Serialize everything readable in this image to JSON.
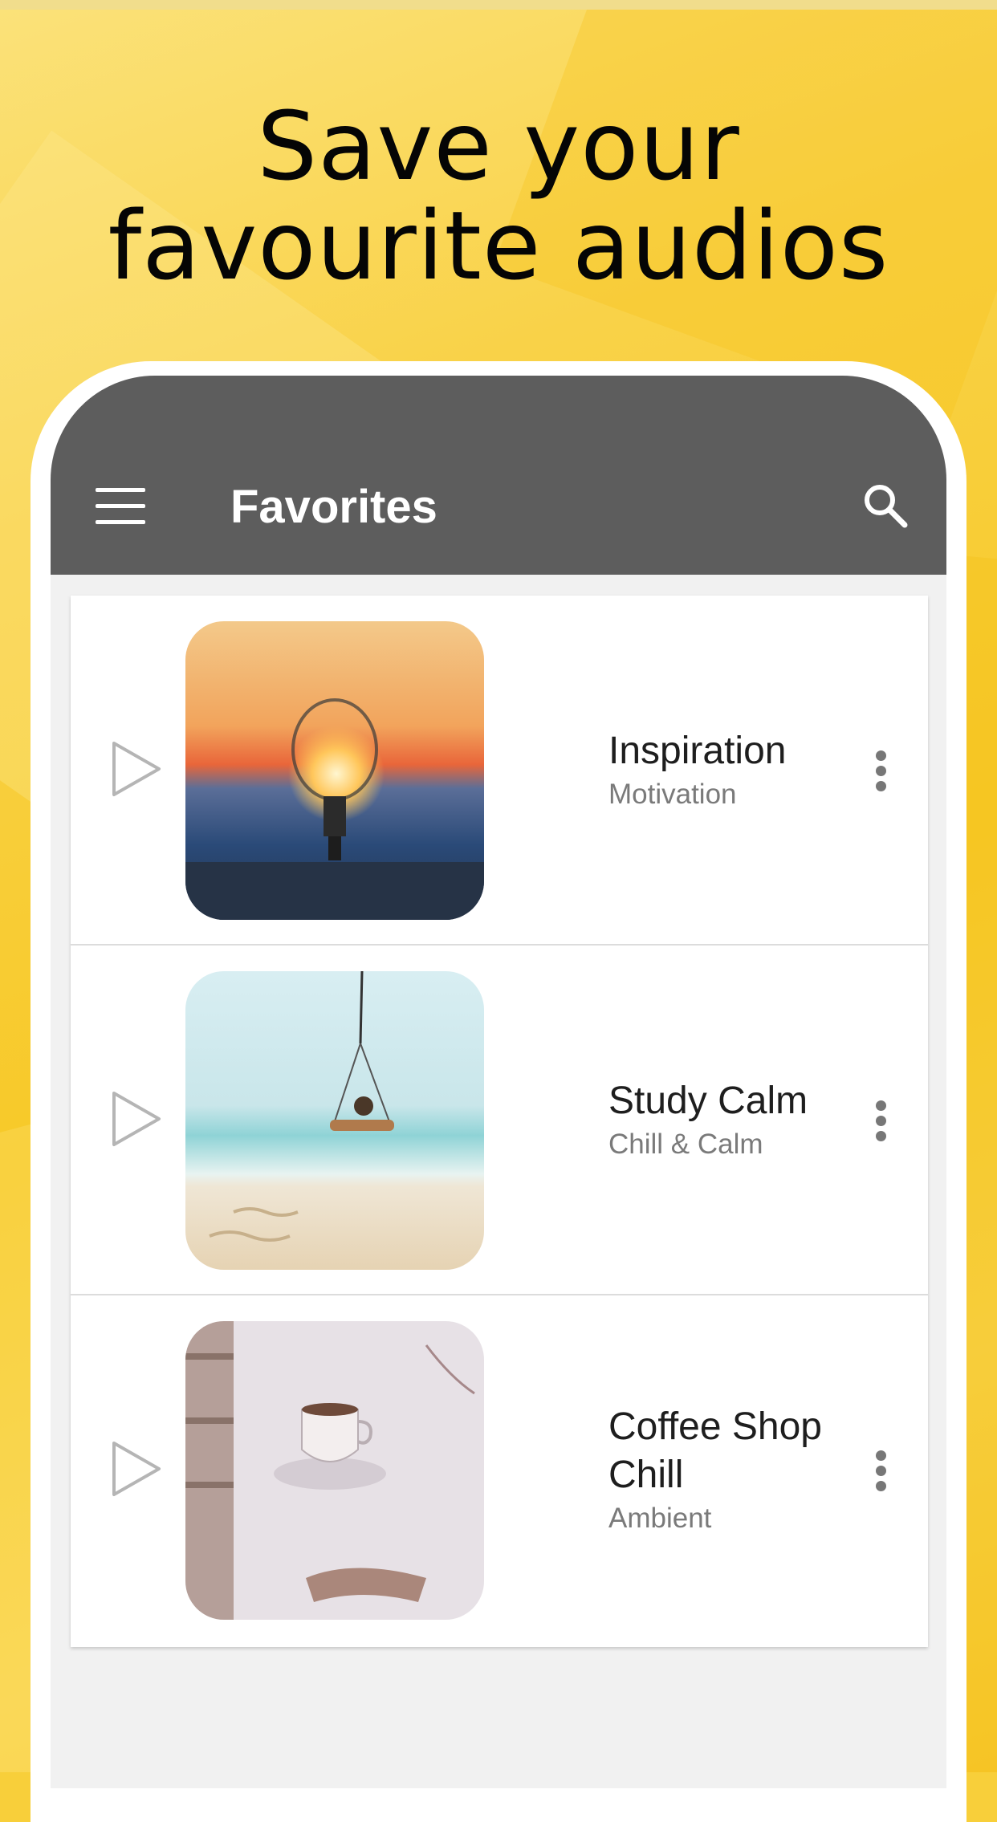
{
  "promo": {
    "headline_line1": "Save your",
    "headline_line2": "favourite audios"
  },
  "appbar": {
    "title": "Favorites",
    "menu_icon": "hamburger-menu-icon",
    "search_icon": "search-icon"
  },
  "favorites": [
    {
      "title": "Inspiration",
      "category": "Motivation",
      "image": "lightbulb-sunset"
    },
    {
      "title": "Study Calm",
      "category": "Chill & Calm",
      "image": "beach-swing"
    },
    {
      "title": "Coffee Shop Chill",
      "category": "Ambient",
      "image": "coffee-cup-books"
    }
  ],
  "colors": {
    "background": "#f8cf3a",
    "appbar": "#5d5d5d",
    "screen": "#f1f1f1"
  }
}
